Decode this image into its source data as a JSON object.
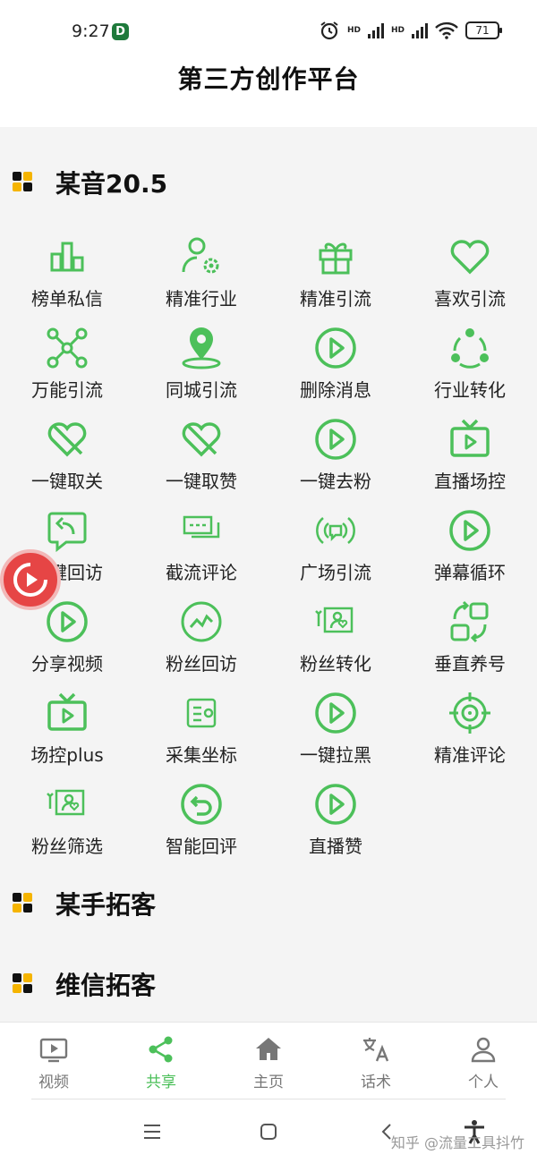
{
  "status": {
    "time": "9:27",
    "badge": "D",
    "net1": "HD",
    "net2": "HD",
    "battery": "71"
  },
  "header": {
    "title": "第三方创作平台"
  },
  "sections": [
    {
      "title": "某音20.5"
    },
    {
      "title": "某手拓客"
    },
    {
      "title": "维信拓客"
    }
  ],
  "accent": "#4cc05a",
  "tiles": [
    {
      "label": "榜单私信",
      "icon": "bar-chart-icon"
    },
    {
      "label": "精准行业",
      "icon": "user-gear-icon"
    },
    {
      "label": "精准引流",
      "icon": "gift-icon"
    },
    {
      "label": "喜欢引流",
      "icon": "heart-icon"
    },
    {
      "label": "万能引流",
      "icon": "hub-icon"
    },
    {
      "label": "同城引流",
      "icon": "location-pin-icon"
    },
    {
      "label": "删除消息",
      "icon": "play-circle-icon"
    },
    {
      "label": "行业转化",
      "icon": "cycle-icon"
    },
    {
      "label": "一键取关",
      "icon": "heart-off-icon"
    },
    {
      "label": "一键取赞",
      "icon": "heart-off-icon"
    },
    {
      "label": "一键去粉",
      "icon": "play-circle-icon"
    },
    {
      "label": "直播场控",
      "icon": "tv-icon"
    },
    {
      "label": "一键回访",
      "icon": "reply-chat-icon"
    },
    {
      "label": "截流评论",
      "icon": "chat-bubbles-icon"
    },
    {
      "label": "广场引流",
      "icon": "broadcast-icon"
    },
    {
      "label": "弹幕循环",
      "icon": "play-circle-icon"
    },
    {
      "label": "分享视频",
      "icon": "play-circle-icon"
    },
    {
      "label": "粉丝回访",
      "icon": "trend-circle-icon"
    },
    {
      "label": "粉丝转化",
      "icon": "photo-heart-icon"
    },
    {
      "label": "垂直养号",
      "icon": "swap-icon"
    },
    {
      "label": "场控plus",
      "icon": "tv-icon"
    },
    {
      "label": "采集坐标",
      "icon": "card-icon"
    },
    {
      "label": "一键拉黑",
      "icon": "play-circle-icon"
    },
    {
      "label": "精准评论",
      "icon": "crosshair-icon"
    },
    {
      "label": "粉丝筛选",
      "icon": "photo-heart-icon"
    },
    {
      "label": "智能回评",
      "icon": "undo-circle-icon"
    },
    {
      "label": "直播赞",
      "icon": "play-circle-icon"
    }
  ],
  "tabs": [
    {
      "label": "视频",
      "icon": "video-icon",
      "active": false
    },
    {
      "label": "共享",
      "icon": "share-icon",
      "active": true
    },
    {
      "label": "主页",
      "icon": "home-icon",
      "active": false
    },
    {
      "label": "话术",
      "icon": "translate-icon",
      "active": false
    },
    {
      "label": "个人",
      "icon": "person-icon",
      "active": false
    }
  ],
  "watermark": "知乎 @流量工具抖竹"
}
